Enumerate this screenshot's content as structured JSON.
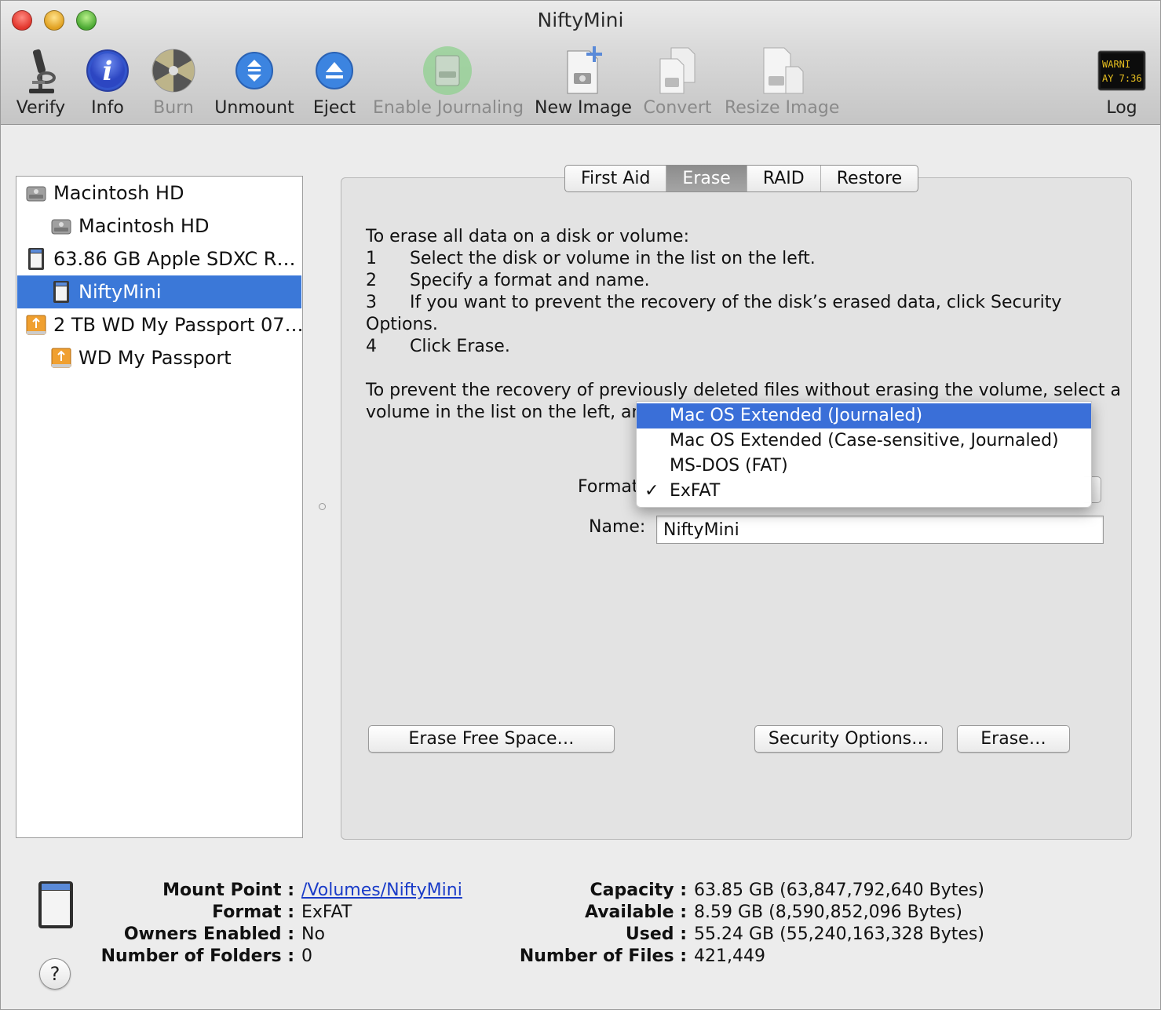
{
  "window": {
    "title": "NiftyMini"
  },
  "toolbar": {
    "verify": "Verify",
    "info": "Info",
    "burn": "Burn",
    "unmount": "Unmount",
    "eject": "Eject",
    "enable_journaling": "Enable Journaling",
    "new_image": "New Image",
    "convert": "Convert",
    "resize_image": "Resize Image",
    "log": "Log",
    "log_icon_text": [
      "WARNI",
      "AY 7:36"
    ]
  },
  "sidebar": {
    "items": [
      {
        "label": "Macintosh HD",
        "icon": "hard-disk-icon"
      },
      {
        "label": "Macintosh HD",
        "icon": "hard-disk-icon"
      },
      {
        "label": "63.86 GB Apple SDXC R…",
        "icon": "sd-card-icon"
      },
      {
        "label": "NiftyMini",
        "icon": "sd-card-icon",
        "selected": true
      },
      {
        "label": "2 TB WD My Passport 07…",
        "icon": "usb-drive-icon"
      },
      {
        "label": "WD My Passport",
        "icon": "usb-drive-icon"
      }
    ]
  },
  "tabs": [
    "First Aid",
    "Erase",
    "RAID",
    "Restore"
  ],
  "active_tab": "Erase",
  "instructions": {
    "heading": "To erase all data on a disk or volume:",
    "steps": [
      {
        "num": "1",
        "text": "Select the disk or volume in the list on the left."
      },
      {
        "num": "2",
        "text": "Specify a format and name."
      },
      {
        "num": "3",
        "text": "If you want to prevent the recovery of the disk’s erased data, click Security"
      },
      {
        "num": "",
        "text": "Options."
      },
      {
        "num": "4",
        "text": "Click Erase."
      }
    ],
    "para_line1": "To prevent the recovery of previously deleted files without erasing the volume, select a",
    "para_line2": "volume in the list on the left, an"
  },
  "form": {
    "format_label": "Format",
    "name_label": "Name:",
    "name_value": "NiftyMini"
  },
  "format_menu": {
    "options": [
      "Mac OS Extended (Journaled)",
      "Mac OS Extended (Case-sensitive, Journaled)",
      "MS-DOS (FAT)",
      "ExFAT"
    ],
    "highlighted": "Mac OS Extended (Journaled)",
    "selected": "ExFAT",
    "check": "✓"
  },
  "buttons": {
    "erase_free_space": "Erase Free Space…",
    "security_options": "Security Options…",
    "erase": "Erase…"
  },
  "info": {
    "mount_point_label": "Mount Point :",
    "mount_point": "/Volumes/NiftyMini",
    "format_label": "Format :",
    "format": "ExFAT",
    "owners_label": "Owners Enabled :",
    "owners": "No",
    "folders_label": "Number of Folders :",
    "folders": "0",
    "capacity_label": "Capacity :",
    "capacity": "63.85 GB (63,847,792,640 Bytes)",
    "available_label": "Available :",
    "available": "8.59 GB (8,590,852,096 Bytes)",
    "used_label": "Used :",
    "used": "55.24 GB (55,240,163,328 Bytes)",
    "files_label": "Number of Files :",
    "files": "421,449"
  },
  "help": "?",
  "colors": {
    "selection": "#3b78d8",
    "menu_highlight": "#3a6fd8",
    "link": "#1a3cc8"
  }
}
